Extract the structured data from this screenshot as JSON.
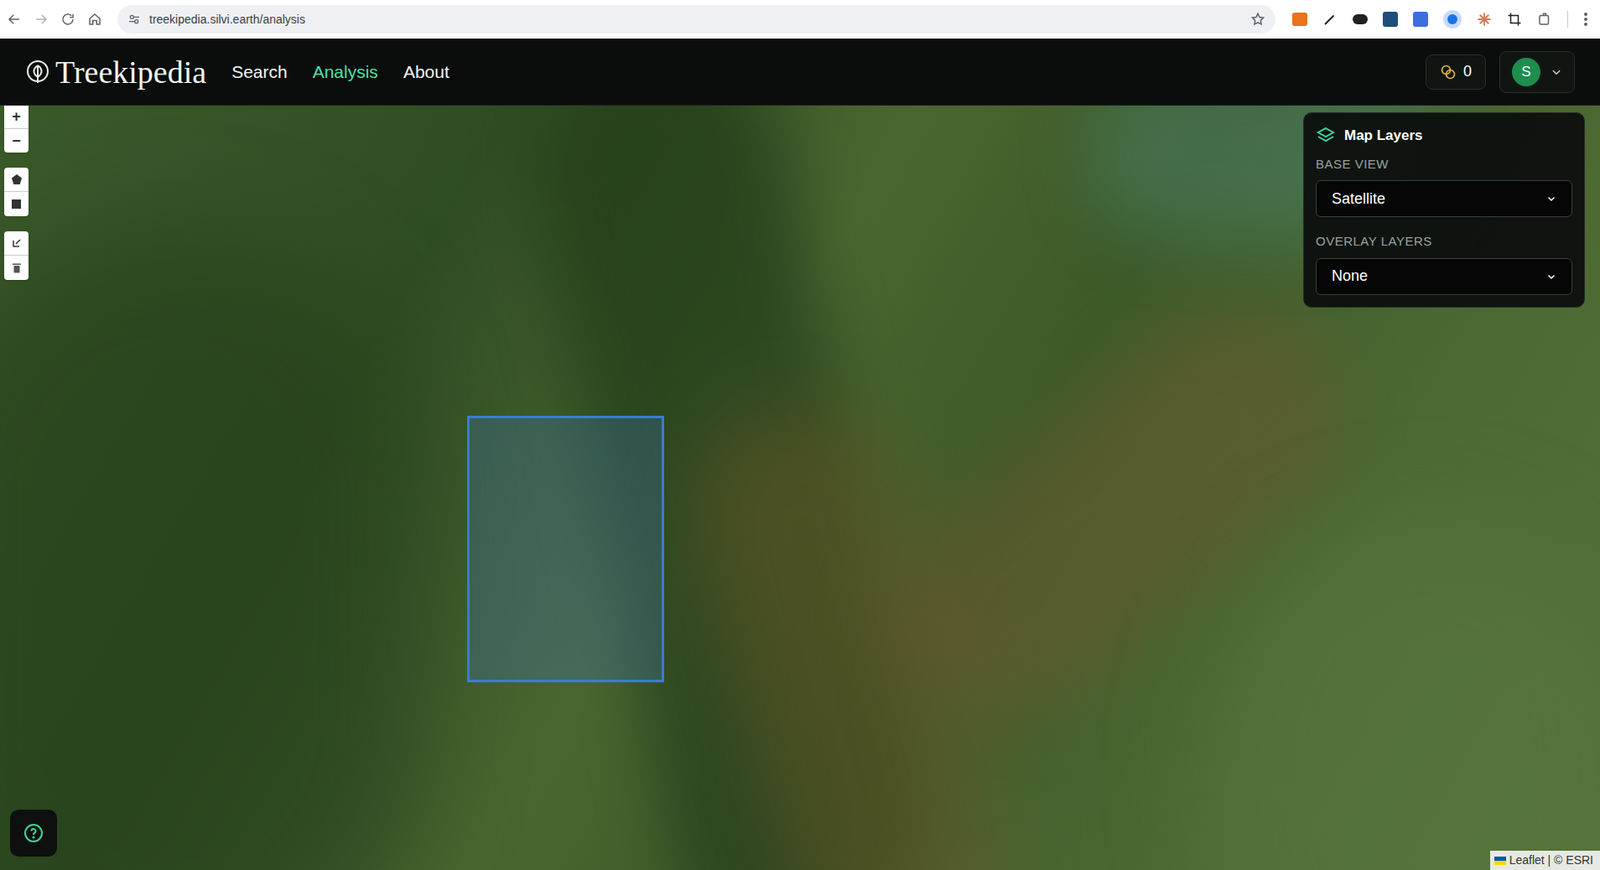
{
  "browser": {
    "url": "treekipedia.silvi.earth/analysis"
  },
  "nav": {
    "logo": "Treekipedia",
    "links": [
      {
        "label": "Search",
        "selected": false
      },
      {
        "label": "Analysis",
        "selected": true
      },
      {
        "label": "About",
        "selected": false
      }
    ],
    "points": "0",
    "avatar": "S"
  },
  "map": {
    "zoom_in": "+",
    "zoom_out": "−",
    "layers_panel": {
      "title": "Map Layers",
      "base_label": "BASE VIEW",
      "base_value": "Satellite",
      "overlay_label": "OVERLAY LAYERS",
      "overlay_value": "None"
    },
    "attribution": "Leaflet | © ESRI"
  }
}
